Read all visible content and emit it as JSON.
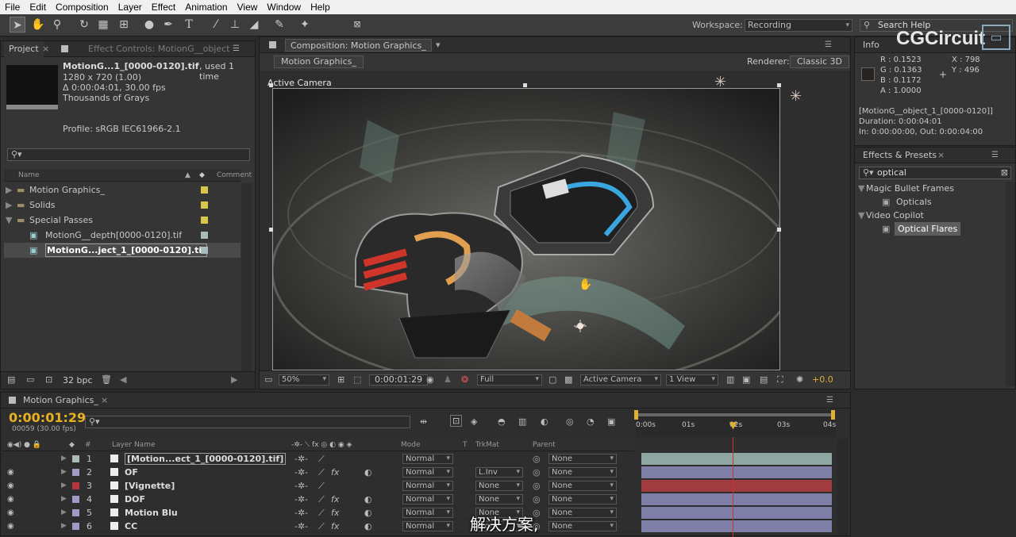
{
  "menu": [
    "File",
    "Edit",
    "Composition",
    "Layer",
    "Effect",
    "Animation",
    "View",
    "Window",
    "Help"
  ],
  "workspace": {
    "label": "Workspace:",
    "value": "Recording"
  },
  "search_help": {
    "placeholder": "Search Help"
  },
  "project": {
    "tab_project": "Project",
    "tab_effect_controls": "Effect Controls: MotionG__object",
    "footage_name": "MotionG...1_[0000-0120].tif",
    "used": ", used 1 time",
    "dims": "1280 x 720 (1.00)",
    "duration": "Δ 0:00:04:01, 30.00 fps",
    "color": "Thousands of Grays",
    "profile": "Profile: sRGB IEC61966-2.1",
    "col_name": "Name",
    "col_comment": "Comment",
    "bpc": "32 bpc",
    "items": [
      {
        "name": "Motion Graphics_",
        "color": "#d8c64a",
        "type": "folder"
      },
      {
        "name": "Solids",
        "color": "#d8c64a",
        "type": "folder"
      },
      {
        "name": "Special Passes",
        "color": "#d8c64a",
        "type": "folder-open"
      },
      {
        "name": "MotionG__depth[0000-0120].tif",
        "color": "#a9bcbb",
        "type": "file"
      },
      {
        "name": "MotionG...ject_1_[0000-0120].tif",
        "color": "#a9bcbb",
        "type": "file",
        "selected": true
      }
    ]
  },
  "comp": {
    "tab": "Composition: Motion Graphics_",
    "sub_tab": "Motion Graphics_",
    "renderer_label": "Renderer:",
    "renderer": "Classic 3D",
    "active_camera": "Active Camera",
    "zoom": "50%",
    "time": "0:00:01:29",
    "resolution": "Full",
    "view": "Active Camera",
    "views": "1 View",
    "exposure": "+0.0"
  },
  "info": {
    "tab": "Info",
    "r": "R : 0.1523",
    "g": "G : 0.1363",
    "b": "B : 0.1172",
    "a": "A : 1.0000",
    "x": "X : 798",
    "y": "Y : 496",
    "layer": "[MotionG__object_1_[0000-0120]]",
    "duration": "Duration: 0:00:04:01",
    "inout": "In: 0:00:00:00, Out: 0:00:04:00"
  },
  "watermark": "CGCircuit",
  "effects": {
    "tab": "Effects & Presets",
    "search": "optical",
    "groups": [
      {
        "name": "Magic Bullet Frames",
        "items": [
          "Opticals"
        ]
      },
      {
        "name": "Video Copilot",
        "items": [
          "Optical Flares"
        ]
      }
    ]
  },
  "timeline": {
    "tab": "Motion Graphics_",
    "timecode": "0:00:01:29",
    "frames": "00059 (30.00 fps)",
    "col_layer": "Layer Name",
    "col_mode": "Mode",
    "col_t": "T",
    "col_trkmat": "TrkMat",
    "col_parent": "Parent",
    "ruler": [
      "0:00s",
      "01s",
      "02s",
      "03s",
      "04s"
    ],
    "playhead_time": "2.0",
    "layers": [
      {
        "num": "1",
        "name": "[Motion...ect_1_[0000-0120].tif]",
        "label": "#a9bcbb",
        "mode": "Normal",
        "trkmat": "",
        "parent": "None",
        "bar": "#8fa7a3",
        "fx": false
      },
      {
        "num": "2",
        "name": "OF",
        "label": "#9e9bc6",
        "mode": "Normal",
        "trkmat": "L.Inv",
        "parent": "None",
        "bar": "#7e7ea6",
        "fx": true
      },
      {
        "num": "3",
        "name": "[Vignette]",
        "label": "#b4363b",
        "mode": "Normal",
        "trkmat": "None",
        "parent": "None",
        "bar": "#a03c40",
        "fx": false
      },
      {
        "num": "4",
        "name": "DOF",
        "label": "#9e9bc6",
        "mode": "Normal",
        "trkmat": "None",
        "parent": "None",
        "bar": "#7e7ea6",
        "fx": true
      },
      {
        "num": "5",
        "name": "Motion Blu",
        "label": "#9e9bc6",
        "mode": "Normal",
        "trkmat": "None",
        "parent": "None",
        "bar": "#7e7ea6",
        "fx": true
      },
      {
        "num": "6",
        "name": "CC",
        "label": "#9e9bc6",
        "mode": "Normal",
        "trkmat": "None",
        "parent": "None",
        "bar": "#7e7ea6",
        "fx": true
      }
    ]
  },
  "subtitle": "解决方案,"
}
